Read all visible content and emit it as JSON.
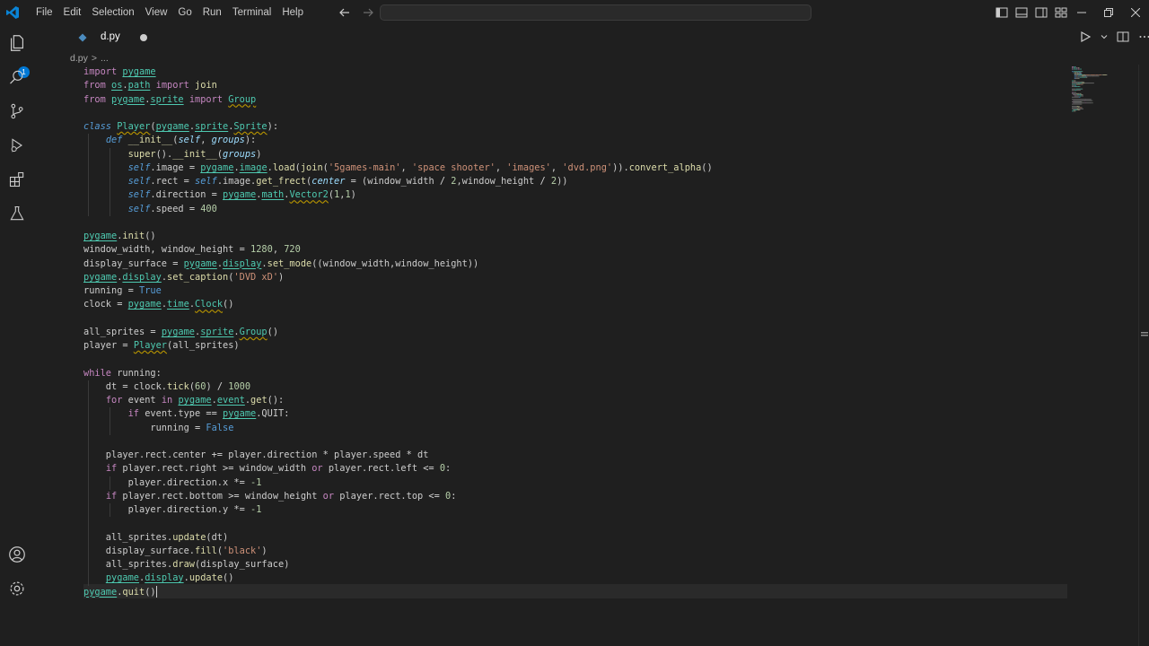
{
  "menu": [
    "File",
    "Edit",
    "Selection",
    "View",
    "Go",
    "Run",
    "Terminal",
    "Help"
  ],
  "activity": {
    "explorer_badge": "1"
  },
  "tab": {
    "label": "d.py"
  },
  "breadcrumb": {
    "file": "d.py",
    "separator": ">",
    "rest": "..."
  },
  "colors": {
    "accent": "#0078d4",
    "background": "#1f1f1f"
  },
  "code": [
    [
      [
        "import",
        "kw"
      ],
      [
        " ",
        ""
      ],
      [
        "pygame",
        "mod"
      ]
    ],
    [
      [
        "from",
        "kw"
      ],
      [
        " ",
        ""
      ],
      [
        "os",
        "mod"
      ],
      [
        ".",
        ""
      ],
      [
        "path",
        "mod"
      ],
      [
        " ",
        ""
      ],
      [
        "import",
        "kw"
      ],
      [
        " ",
        ""
      ],
      [
        "join",
        "fn"
      ]
    ],
    [
      [
        "from",
        "kw"
      ],
      [
        " ",
        ""
      ],
      [
        "pygame",
        "mod"
      ],
      [
        ".",
        ""
      ],
      [
        "sprite",
        "mod"
      ],
      [
        " ",
        ""
      ],
      [
        "import",
        "kw"
      ],
      [
        " ",
        ""
      ],
      [
        "Group",
        "cls sq"
      ]
    ],
    [],
    [
      [
        "class",
        "dfn"
      ],
      [
        " ",
        ""
      ],
      [
        "Player",
        "cls sq"
      ],
      [
        "(",
        ""
      ],
      [
        "pygame",
        "mod"
      ],
      [
        ".",
        ""
      ],
      [
        "sprite",
        "mod"
      ],
      [
        ".",
        ""
      ],
      [
        "Sprite",
        "cls sq"
      ],
      [
        "):",
        ""
      ]
    ],
    [
      [
        "    ",
        ""
      ],
      [
        "def",
        "dfn"
      ],
      [
        " ",
        ""
      ],
      [
        "__init__",
        "fn"
      ],
      [
        "(",
        ""
      ],
      [
        "self",
        "prm"
      ],
      [
        ", ",
        ""
      ],
      [
        "groups",
        "prm"
      ],
      [
        "):",
        ""
      ]
    ],
    [
      [
        "        ",
        ""
      ],
      [
        "super",
        "fn"
      ],
      [
        "().",
        ""
      ],
      [
        "__init__",
        "fn"
      ],
      [
        "(",
        ""
      ],
      [
        "groups",
        "prm"
      ],
      [
        ")",
        ""
      ]
    ],
    [
      [
        "        ",
        ""
      ],
      [
        "self",
        "slf"
      ],
      [
        ".image ",
        ""
      ],
      [
        "=",
        "op"
      ],
      [
        " ",
        ""
      ],
      [
        "pygame",
        "mod"
      ],
      [
        ".",
        ""
      ],
      [
        "image",
        "mod"
      ],
      [
        ".",
        ""
      ],
      [
        "load",
        "fn"
      ],
      [
        "(",
        ""
      ],
      [
        "join",
        "fn"
      ],
      [
        "(",
        ""
      ],
      [
        "'5games-main'",
        "str"
      ],
      [
        ", ",
        ""
      ],
      [
        "'space shooter'",
        "str"
      ],
      [
        ", ",
        ""
      ],
      [
        "'images'",
        "str"
      ],
      [
        ", ",
        ""
      ],
      [
        "'dvd.png'",
        "str"
      ],
      [
        ")).",
        ""
      ],
      [
        "convert_alpha",
        "fn"
      ],
      [
        "()",
        ""
      ]
    ],
    [
      [
        "        ",
        ""
      ],
      [
        "self",
        "slf"
      ],
      [
        ".rect ",
        ""
      ],
      [
        "=",
        "op"
      ],
      [
        " ",
        ""
      ],
      [
        "self",
        "slf"
      ],
      [
        ".image.",
        ""
      ],
      [
        "get_frect",
        "fn"
      ],
      [
        "(",
        ""
      ],
      [
        "center",
        "prm"
      ],
      [
        " ",
        ""
      ],
      [
        "=",
        "op"
      ],
      [
        " (window_width ",
        ""
      ],
      [
        "/",
        "op"
      ],
      [
        " ",
        ""
      ],
      [
        "2",
        "num"
      ],
      [
        ",window_height ",
        ""
      ],
      [
        "/",
        "op"
      ],
      [
        " ",
        ""
      ],
      [
        "2",
        "num"
      ],
      [
        "))",
        ""
      ]
    ],
    [
      [
        "        ",
        ""
      ],
      [
        "self",
        "slf"
      ],
      [
        ".direction ",
        ""
      ],
      [
        "=",
        "op"
      ],
      [
        " ",
        ""
      ],
      [
        "pygame",
        "mod"
      ],
      [
        ".",
        ""
      ],
      [
        "math",
        "mod"
      ],
      [
        ".",
        ""
      ],
      [
        "Vector2",
        "cls sq"
      ],
      [
        "(",
        ""
      ],
      [
        "1",
        "num"
      ],
      [
        ",",
        ""
      ],
      [
        "1",
        "num"
      ],
      [
        ")",
        ""
      ]
    ],
    [
      [
        "        ",
        ""
      ],
      [
        "self",
        "slf"
      ],
      [
        ".speed ",
        ""
      ],
      [
        "=",
        "op"
      ],
      [
        " ",
        ""
      ],
      [
        "400",
        "num"
      ]
    ],
    [],
    [
      [
        "pygame",
        "mod"
      ],
      [
        ".",
        ""
      ],
      [
        "init",
        "fn"
      ],
      [
        "()",
        ""
      ]
    ],
    [
      [
        "window_width, window_height ",
        ""
      ],
      [
        "=",
        "op"
      ],
      [
        " ",
        ""
      ],
      [
        "1280",
        "num"
      ],
      [
        ", ",
        ""
      ],
      [
        "720",
        "num"
      ]
    ],
    [
      [
        "display_surface ",
        ""
      ],
      [
        "=",
        "op"
      ],
      [
        " ",
        ""
      ],
      [
        "pygame",
        "mod"
      ],
      [
        ".",
        ""
      ],
      [
        "display",
        "mod"
      ],
      [
        ".",
        ""
      ],
      [
        "set_mode",
        "fn"
      ],
      [
        "((window_width,window_height))",
        ""
      ]
    ],
    [
      [
        "pygame",
        "mod"
      ],
      [
        ".",
        ""
      ],
      [
        "display",
        "mod"
      ],
      [
        ".",
        ""
      ],
      [
        "set_caption",
        "fn"
      ],
      [
        "(",
        ""
      ],
      [
        "'DVD xD'",
        "str"
      ],
      [
        ")",
        ""
      ]
    ],
    [
      [
        "running ",
        ""
      ],
      [
        "=",
        "op"
      ],
      [
        " ",
        ""
      ],
      [
        "True",
        "cst"
      ]
    ],
    [
      [
        "clock ",
        ""
      ],
      [
        "=",
        "op"
      ],
      [
        " ",
        ""
      ],
      [
        "pygame",
        "mod"
      ],
      [
        ".",
        ""
      ],
      [
        "time",
        "mod"
      ],
      [
        ".",
        ""
      ],
      [
        "Clock",
        "cls sq"
      ],
      [
        "()",
        ""
      ]
    ],
    [],
    [
      [
        "all_sprites ",
        ""
      ],
      [
        "=",
        "op"
      ],
      [
        " ",
        ""
      ],
      [
        "pygame",
        "mod"
      ],
      [
        ".",
        ""
      ],
      [
        "sprite",
        "mod"
      ],
      [
        ".",
        ""
      ],
      [
        "Group",
        "cls sq"
      ],
      [
        "()",
        ""
      ]
    ],
    [
      [
        "player ",
        ""
      ],
      [
        "=",
        "op"
      ],
      [
        " ",
        ""
      ],
      [
        "Player",
        "cls sq"
      ],
      [
        "(all_sprites)",
        ""
      ]
    ],
    [],
    [
      [
        "while",
        "kw"
      ],
      [
        " running:",
        ""
      ]
    ],
    [
      [
        "    dt ",
        ""
      ],
      [
        "=",
        "op"
      ],
      [
        " clock.",
        ""
      ],
      [
        "tick",
        "fn"
      ],
      [
        "(",
        ""
      ],
      [
        "60",
        "num"
      ],
      [
        ") ",
        ""
      ],
      [
        "/",
        "op"
      ],
      [
        " ",
        ""
      ],
      [
        "1000",
        "num"
      ]
    ],
    [
      [
        "    ",
        ""
      ],
      [
        "for",
        "kw"
      ],
      [
        " event ",
        ""
      ],
      [
        "in",
        "kw"
      ],
      [
        " ",
        ""
      ],
      [
        "pygame",
        "mod"
      ],
      [
        ".",
        ""
      ],
      [
        "event",
        "mod"
      ],
      [
        ".",
        ""
      ],
      [
        "get",
        "fn"
      ],
      [
        "():",
        ""
      ]
    ],
    [
      [
        "        ",
        ""
      ],
      [
        "if",
        "kw"
      ],
      [
        " event.type ",
        ""
      ],
      [
        "==",
        "op"
      ],
      [
        " ",
        ""
      ],
      [
        "pygame",
        "mod"
      ],
      [
        ".QUIT:",
        ""
      ]
    ],
    [
      [
        "            running ",
        ""
      ],
      [
        "=",
        "op"
      ],
      [
        " ",
        ""
      ],
      [
        "False",
        "cst"
      ]
    ],
    [],
    [
      [
        "    player.rect.center ",
        ""
      ],
      [
        "+=",
        "op"
      ],
      [
        " player.direction ",
        ""
      ],
      [
        "*",
        "op"
      ],
      [
        " player.speed ",
        ""
      ],
      [
        "*",
        "op"
      ],
      [
        " dt",
        ""
      ]
    ],
    [
      [
        "    ",
        ""
      ],
      [
        "if",
        "kw"
      ],
      [
        " player.rect.right ",
        ""
      ],
      [
        ">=",
        "op"
      ],
      [
        " window_width ",
        ""
      ],
      [
        "or",
        "kw"
      ],
      [
        " player.rect.left ",
        ""
      ],
      [
        "<=",
        "op"
      ],
      [
        " ",
        ""
      ],
      [
        "0",
        "num"
      ],
      [
        ":",
        ""
      ]
    ],
    [
      [
        "        player.direction.x ",
        ""
      ],
      [
        "*=",
        "op"
      ],
      [
        " ",
        ""
      ],
      [
        "-1",
        "num"
      ]
    ],
    [
      [
        "    ",
        ""
      ],
      [
        "if",
        "kw"
      ],
      [
        " player.rect.bottom ",
        ""
      ],
      [
        ">=",
        "op"
      ],
      [
        " window_height ",
        ""
      ],
      [
        "or",
        "kw"
      ],
      [
        " player.rect.top ",
        ""
      ],
      [
        "<=",
        "op"
      ],
      [
        " ",
        ""
      ],
      [
        "0",
        "num"
      ],
      [
        ":",
        ""
      ]
    ],
    [
      [
        "        player.direction.y ",
        ""
      ],
      [
        "*=",
        "op"
      ],
      [
        " ",
        ""
      ],
      [
        "-1",
        "num"
      ]
    ],
    [],
    [
      [
        "    all_sprites.",
        ""
      ],
      [
        "update",
        "fn"
      ],
      [
        "(dt)",
        ""
      ]
    ],
    [
      [
        "    display_surface.",
        ""
      ],
      [
        "fill",
        "fn"
      ],
      [
        "(",
        ""
      ],
      [
        "'black'",
        "str"
      ],
      [
        ")",
        ""
      ]
    ],
    [
      [
        "    all_sprites.",
        ""
      ],
      [
        "draw",
        "fn"
      ],
      [
        "(display_surface)",
        ""
      ]
    ],
    [
      [
        "    ",
        ""
      ],
      [
        "pygame",
        "mod"
      ],
      [
        ".",
        ""
      ],
      [
        "display",
        "mod"
      ],
      [
        ".",
        ""
      ],
      [
        "update",
        "fn"
      ],
      [
        "()",
        ""
      ]
    ],
    [
      [
        "pygame",
        "mod"
      ],
      [
        ".",
        ""
      ],
      [
        "quit",
        "fn"
      ],
      [
        "()",
        ""
      ]
    ]
  ]
}
